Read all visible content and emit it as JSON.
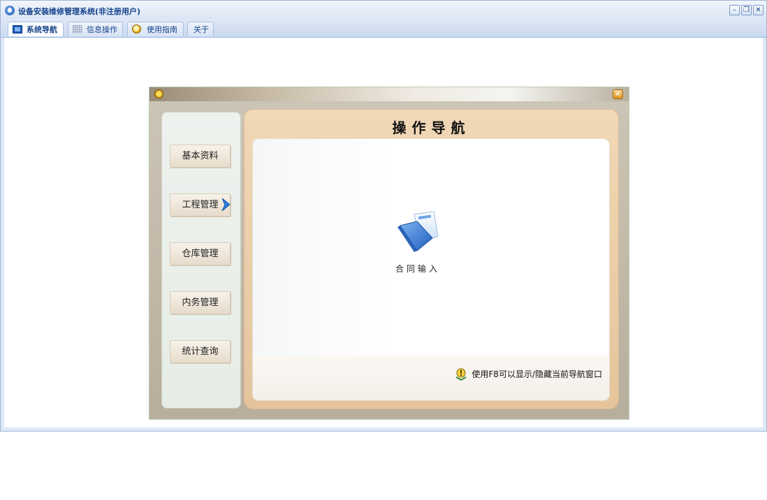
{
  "window": {
    "title": "设备安装维修管理系统(非注册用户)",
    "minimize": "–",
    "restore": "❐",
    "close": "✕"
  },
  "tabs": [
    {
      "label": "系统导航",
      "icon": "navigation-icon",
      "active": true
    },
    {
      "label": "信息操作",
      "icon": "grid-icon",
      "active": false
    },
    {
      "label": "使用指南",
      "icon": "guide-icon",
      "active": false
    },
    {
      "label": "关于",
      "icon": "",
      "active": false
    }
  ],
  "dialog": {
    "close": "✕",
    "heading": "操作导航",
    "side_buttons": [
      {
        "label": "基本资料"
      },
      {
        "label": "工程管理",
        "selected": true
      },
      {
        "label": "仓库管理"
      },
      {
        "label": "内务管理"
      },
      {
        "label": "统计查询"
      }
    ],
    "functions": [
      {
        "label": "合同输入",
        "icon": "document-icon"
      }
    ],
    "hint": "使用F8可以显示/隐藏当前导航窗口"
  },
  "colors": {
    "accent": "#15428b",
    "panel_tan": "#e9c9a2",
    "side_green": "#eaefea"
  }
}
